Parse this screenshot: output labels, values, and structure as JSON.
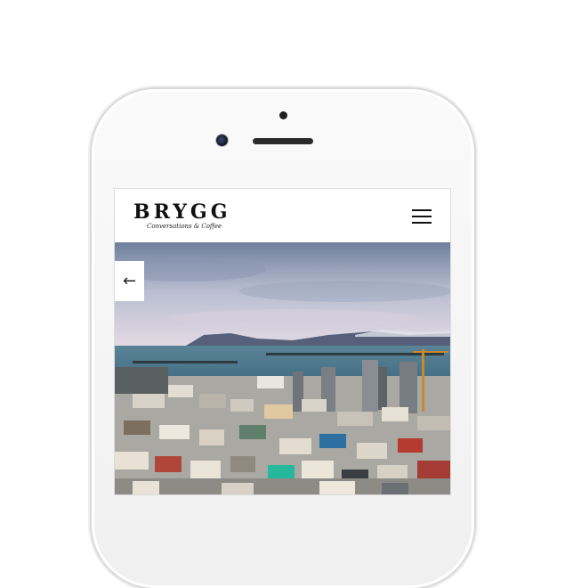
{
  "brand": {
    "name": "BRYGG",
    "tagline": "Conversations & Coffee"
  },
  "nav": {
    "menu_icon": "hamburger-menu-icon"
  },
  "slider": {
    "prev_arrow": "←",
    "prev_icon": "arrow-left-icon"
  },
  "colors": {
    "sky_top": "#6f7f9c",
    "sky_bottom": "#e6dbe6",
    "sea": "#3f6e86",
    "text": "#111111"
  }
}
